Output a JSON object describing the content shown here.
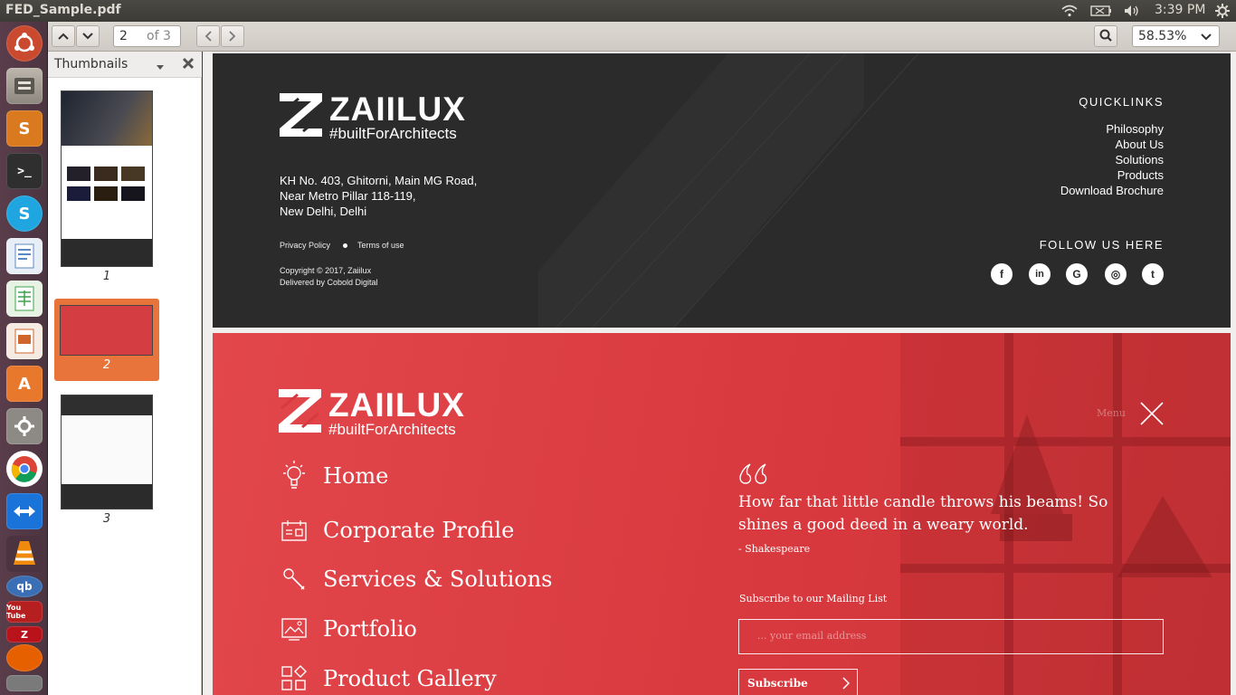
{
  "window": {
    "title": "FED_Sample.pdf"
  },
  "topbar": {
    "clock": "3:39 PM",
    "indicators": [
      "wifi-icon",
      "battery-icon",
      "volume-icon",
      "gear-icon"
    ]
  },
  "launcher": {
    "items": [
      "ubuntu-dash",
      "files",
      "sublime-text",
      "terminal",
      "skype",
      "libreoffice-writer",
      "libreoffice-calc",
      "libreoffice-impress",
      "ubuntu-software-center",
      "system-settings",
      "chrome",
      "teamviewer",
      "vlc",
      "qbittorrent",
      "youtube-downloader",
      "filezilla",
      "firefox",
      "unknown"
    ]
  },
  "toolbar": {
    "page_current": "2",
    "page_total": "of 3",
    "zoom": "58.53%"
  },
  "sidebar": {
    "title": "Thumbnails",
    "thumbs": [
      {
        "label": "1"
      },
      {
        "label": "2"
      },
      {
        "label": "3"
      }
    ]
  },
  "page1": {
    "brand": "ZAIILUX",
    "tagline": "#builtForArchitects",
    "address": [
      "KH No. 403, Ghitorni, Main MG Road,",
      "Near Metro Pillar 118-119,",
      "New Delhi, Delhi"
    ],
    "privacy": "Privacy Policy",
    "terms": "Terms of use",
    "copyright": "Copyright © 2017, Zaiilux",
    "delivered": "Delivered by Cobold Digital",
    "quicklinks_title": "QUICKLINKS",
    "quicklinks": [
      "Philosophy",
      "About Us",
      "Solutions",
      "Products",
      "Download Brochure"
    ],
    "follow_title": "FOLLOW US HERE",
    "socials": [
      {
        "icon": "facebook-icon",
        "glyph": "f"
      },
      {
        "icon": "linkedin-icon",
        "glyph": "in"
      },
      {
        "icon": "google-icon",
        "glyph": "G"
      },
      {
        "icon": "instagram-icon",
        "glyph": "◎"
      },
      {
        "icon": "twitter-icon",
        "glyph": "t"
      }
    ]
  },
  "page2": {
    "brand": "ZAIILUX",
    "tagline": "#builtForArchitects",
    "menu_label": "Menu",
    "nav": [
      {
        "label": "Home",
        "icon": "bulb-icon"
      },
      {
        "label": "Corporate Profile",
        "icon": "id-card-icon"
      },
      {
        "label": "Services & Solutions",
        "icon": "wrench-icon"
      },
      {
        "label": "Portfolio",
        "icon": "picture-icon"
      },
      {
        "label": "Product Gallery",
        "icon": "grid-shapes-icon"
      }
    ],
    "quote_mark": "“",
    "quote": "How far that little candle throws his beams! So shines a good deed in a weary world.",
    "quote_author": "- Shakespeare",
    "subscribe_title": "Subscribe to our Mailing List",
    "email_placeholder": "... your email address",
    "subscribe_button": "Subscribe"
  },
  "colors": {
    "footer_dark": "#2b2b2b",
    "brand_red": "#de4448",
    "selected_thumb": "#e8743b"
  }
}
